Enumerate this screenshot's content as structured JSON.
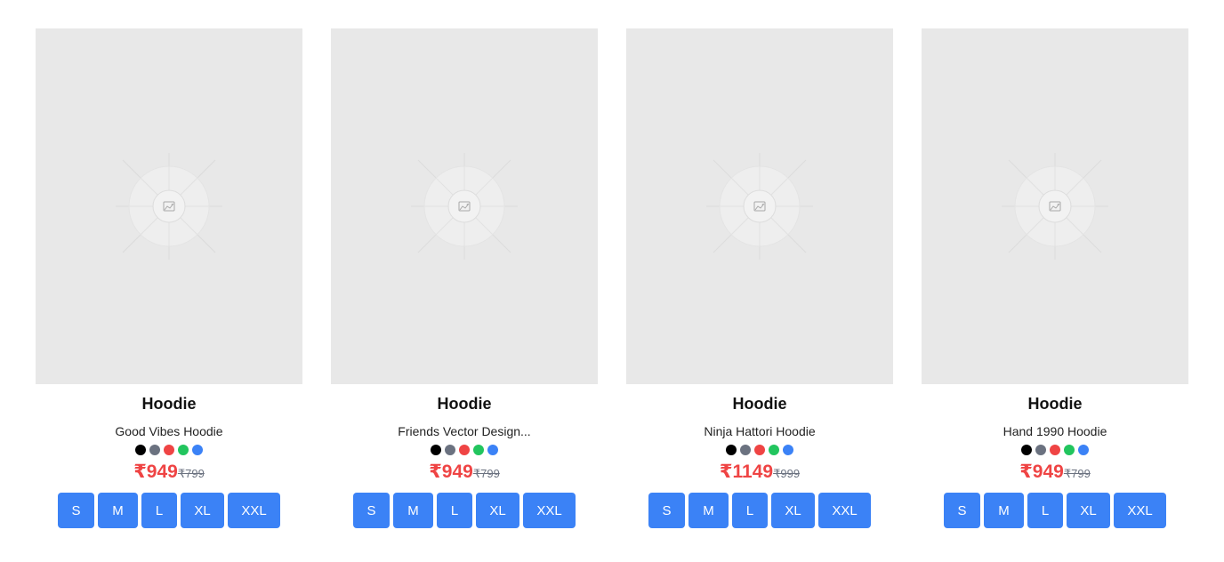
{
  "products": [
    {
      "category": "Hoodie",
      "name": "Good Vibes Hoodie",
      "price": "₹949",
      "old_price": "₹799",
      "colors": [
        "#000000",
        "#6b7280",
        "#ef4444",
        "#22c55e",
        "#3b82f6"
      ],
      "sizes": [
        "S",
        "M",
        "L",
        "XL",
        "XXL"
      ]
    },
    {
      "category": "Hoodie",
      "name": "Friends Vector Design...",
      "price": "₹949",
      "old_price": "₹799",
      "colors": [
        "#000000",
        "#6b7280",
        "#ef4444",
        "#22c55e",
        "#3b82f6"
      ],
      "sizes": [
        "S",
        "M",
        "L",
        "XL",
        "XXL"
      ]
    },
    {
      "category": "Hoodie",
      "name": "Ninja Hattori Hoodie",
      "price": "₹1149",
      "old_price": "₹999",
      "colors": [
        "#000000",
        "#6b7280",
        "#ef4444",
        "#22c55e",
        "#3b82f6"
      ],
      "sizes": [
        "S",
        "M",
        "L",
        "XL",
        "XXL"
      ]
    },
    {
      "category": "Hoodie",
      "name": "Hand 1990 Hoodie",
      "price": "₹949",
      "old_price": "₹799",
      "colors": [
        "#000000",
        "#6b7280",
        "#ef4444",
        "#22c55e",
        "#3b82f6"
      ],
      "sizes": [
        "S",
        "M",
        "L",
        "XL",
        "XXL"
      ]
    }
  ],
  "placeholder_icon": "image-placeholder-icon",
  "accent_color": "#3b82f6",
  "price_color": "#ef4444"
}
